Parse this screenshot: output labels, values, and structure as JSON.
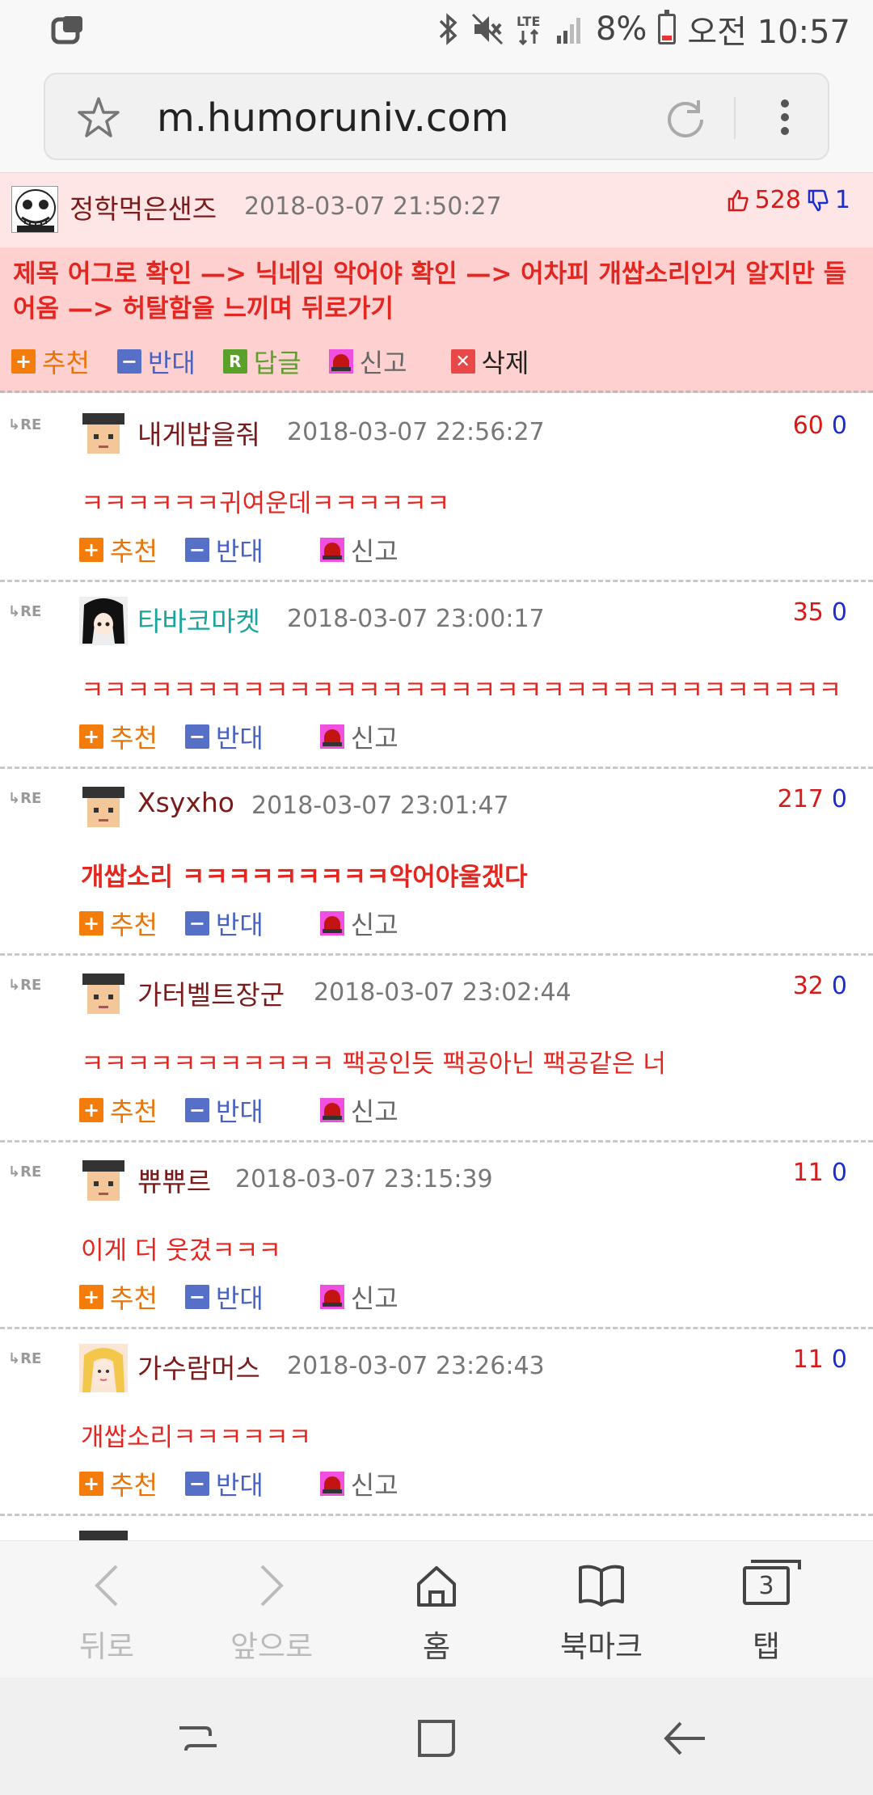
{
  "status_bar": {
    "battery": "8%",
    "time": "오전 10:57",
    "network": "LTE"
  },
  "url_bar": {
    "url": "m.humoruniv.com"
  },
  "post": {
    "author": "정학먹은샌즈",
    "date": "2018-03-07 21:50:27",
    "up_votes": "528",
    "down_votes": "1",
    "text": "제목 어그로 확인 —> 닉네임 악어야 확인 —> 어차피 개쌉소리인거 알지만 들어옴 —> 허탈함을 느끼며 뒤로가기",
    "actions": {
      "recommend": "추천",
      "oppose": "반대",
      "reply": "답글",
      "report": "신고",
      "delete": "삭제"
    }
  },
  "comment_actions": {
    "recommend": "추천",
    "oppose": "반대",
    "report": "신고"
  },
  "comments": [
    {
      "author": "내게밥을줘",
      "date": "2018-03-07 22:56:27",
      "up": "60",
      "down": "0",
      "text": "ㅋㅋㅋㅋㅋㅋ귀여운데ㅋㅋㅋㅋㅋㅋ"
    },
    {
      "author": "타바코마켓",
      "date": "2018-03-07 23:00:17",
      "up": "35",
      "down": "0",
      "text": "ㅋㅋㅋㅋㅋㅋㅋㅋㅋㅋㅋㅋㅋㅋㅋㅋㅋㅋㅋㅋㅋㅋㅋㅋㅋㅋㅋㅋㅋㅋㅋㅋㅋ"
    },
    {
      "author": "Xsyxho",
      "date": "2018-03-07 23:01:47",
      "up": "217",
      "down": "0",
      "text": "개쌉소리 ㅋㅋㅋㅋㅋㅋㅋㅋㅋ악어야울겠다"
    },
    {
      "author": "가터벨트장군",
      "date": "2018-03-07 23:02:44",
      "up": "32",
      "down": "0",
      "text": "ㅋㅋㅋㅋㅋㅋㅋㅋㅋㅋㅋ 팩공인듯 팩공아닌 팩공같은 너"
    },
    {
      "author": "쀼쀼르",
      "date": "2018-03-07 23:15:39",
      "up": "11",
      "down": "0",
      "text": "이게 더 웃겼ㅋㅋㅋ"
    },
    {
      "author": "가수람머스",
      "date": "2018-03-07 23:26:43",
      "up": "11",
      "down": "0",
      "text": "개쌉소리ㅋㅋㅋㅋㅋㅋ"
    }
  ],
  "re_label": "RE",
  "bottom_nav": {
    "back": "뒤로",
    "forward": "앞으로",
    "home": "홈",
    "bookmarks": "북마크",
    "tabs": "탭",
    "tab_count": "3"
  },
  "icons": {
    "status": [
      "app-icon",
      "bluetooth-icon",
      "mute-icon",
      "lte-icon",
      "signal-icon",
      "battery-icon"
    ],
    "url": [
      "star-icon",
      "reload-icon",
      "menu-icon"
    ]
  },
  "colors": {
    "post_header_bg": "#ffe6e6",
    "post_body_bg": "#ffd0d0",
    "comment_text": "#e3261f",
    "author": "#7b1a1a",
    "up_vote": "#d61a1a",
    "down_vote": "#1a2ecf"
  }
}
